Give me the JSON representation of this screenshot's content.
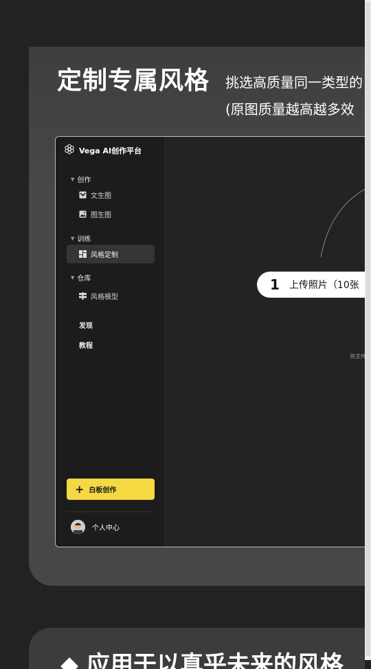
{
  "hero": {
    "title": "定制专属风格",
    "subtitle_line1": "挑选高质量同一类型的",
    "subtitle_line2": "(原图质量越高越多效"
  },
  "app": {
    "brand": "Vega AI创作平台",
    "sections": {
      "create": "创作",
      "train": "训练",
      "warehouse": "仓库"
    },
    "nav": {
      "text_to_image": "文生图",
      "image_to_image": "图生图",
      "style_custom": "风格定制",
      "style_model": "风格模型",
      "discover": "发现",
      "tutorial": "教程"
    },
    "cta_label": "白板创作",
    "profile_label": "个人中心",
    "upload": {
      "step": "1",
      "label": "上传照片（10张"
    },
    "drop_hint": "将文件"
  },
  "next_section": {
    "title": "◆ 应用于以真乎未来的风格"
  },
  "colors": {
    "background": "#222222",
    "card": "#474747",
    "accent": "#f6d843",
    "sidebar": "#1c1c1c"
  }
}
